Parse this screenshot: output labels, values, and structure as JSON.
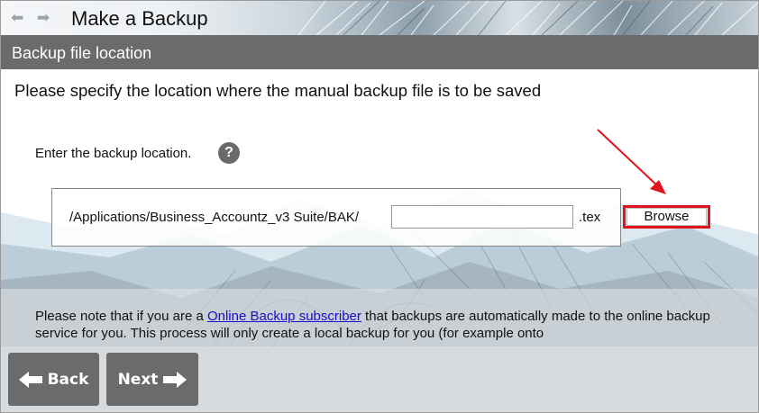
{
  "window": {
    "title": "Make a Backup",
    "nav_back_glyph": "⬅",
    "nav_forward_glyph": "➡"
  },
  "section": {
    "header": "Backup file location"
  },
  "main": {
    "instruction": "Please specify the location where the manual backup file is to be saved",
    "enter_label": "Enter the backup location.",
    "help_glyph": "?",
    "path_prefix": "/Applications/Business_Accountz_v3 Suite/BAK/",
    "filename_value": "",
    "filename_placeholder": "",
    "extension": ".tex",
    "browse_label": "Browse"
  },
  "note": {
    "prefix": "Please note that if you are a ",
    "link": "Online Backup subscriber",
    "suffix": " that backups are automatically made to the online backup service for you. This process will only create a local backup for you (for example onto"
  },
  "footer": {
    "back_label": "Back",
    "next_label": "Next"
  },
  "colors": {
    "header_bg": "#6b6b6b",
    "highlight": "#e0141c",
    "link": "#1a0dcc"
  },
  "icons": {
    "nav_back": "arrow-left-icon",
    "nav_forward": "arrow-right-icon",
    "help": "help-icon",
    "back": "arrow-left-icon",
    "next": "arrow-right-icon"
  }
}
